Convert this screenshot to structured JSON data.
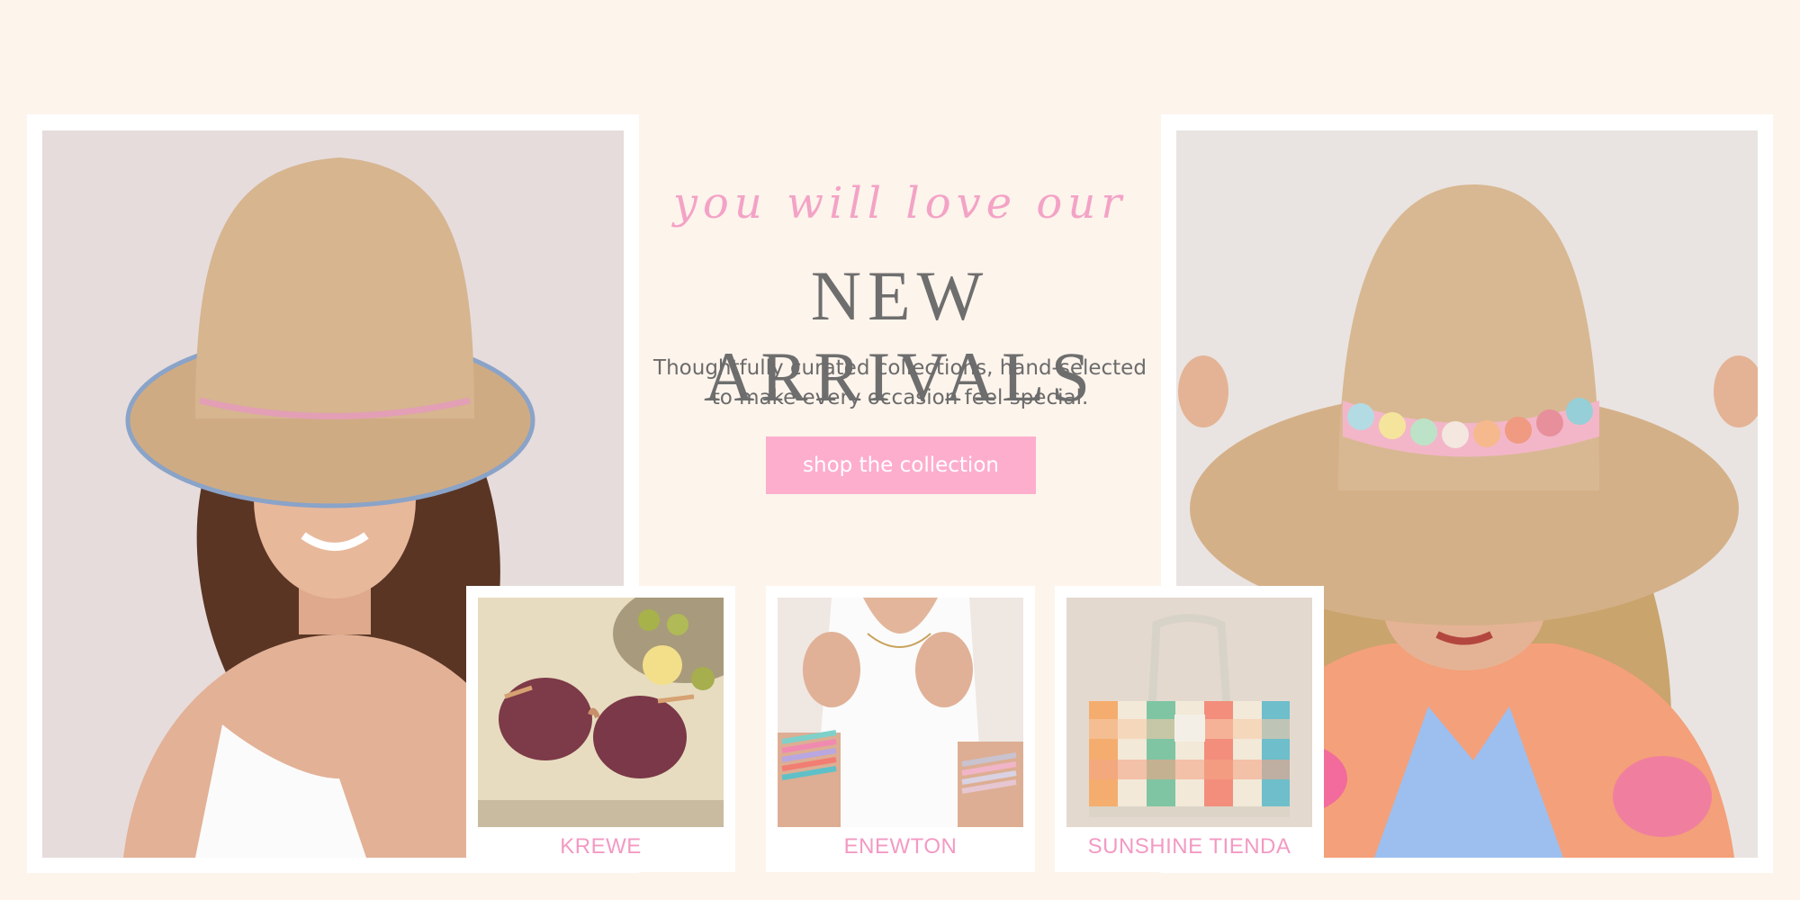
{
  "hero": {
    "tagline": "you will love our",
    "headline": "NEW ARRIVALS",
    "description": "Thoughtfully curated collections,  hand-selected to make every occasion feel special.",
    "cta_label": "shop the collection"
  },
  "brands": [
    {
      "label": "KREWE"
    },
    {
      "label": "ENEWTON"
    },
    {
      "label": "SUNSHINE TIENDA"
    }
  ],
  "colors": {
    "background": "#fdf4ec",
    "accent_pink": "#fdaecd",
    "label_pink": "#f39ac3",
    "heading_gray": "#6e6e6e"
  }
}
